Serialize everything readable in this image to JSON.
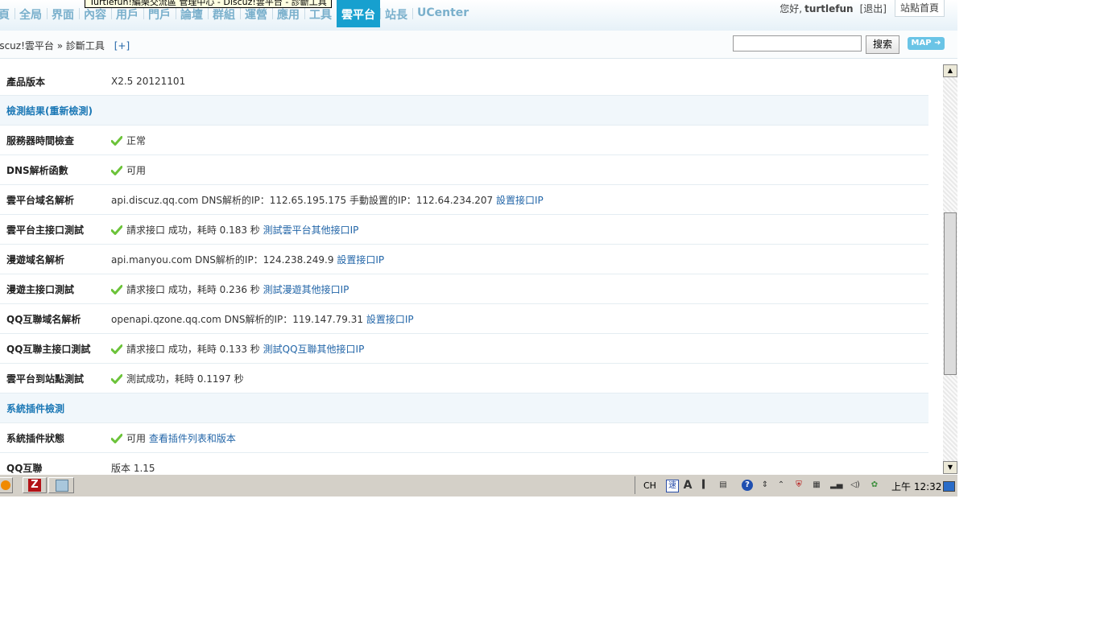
{
  "tooltip": "Turtlefun!編樂交流區 管理中心 - Discuz!雲平台 - 診斷工具",
  "nav": [
    "首頁",
    "全局",
    "界面",
    "內容",
    "用戶",
    "門戶",
    "論壇",
    "群組",
    "運營",
    "應用",
    "工具",
    "雲平台",
    "站長",
    "UCenter"
  ],
  "nav_display": [
    "頁",
    "全局",
    "界面",
    "內容",
    "用戶",
    "門戶",
    "論壇",
    "群組",
    "運營",
    "應用",
    "工具",
    "雲平台",
    "站長",
    "UCenter"
  ],
  "nav_active": "雲平台",
  "user": {
    "greeting": "您好,",
    "name": "turtlefun",
    "logout": "[退出]",
    "site_home": "站點首頁"
  },
  "breadcrumb": {
    "root": "Discuz!雲平台",
    "separator": "»",
    "current": "診斷工具",
    "add": "[+]"
  },
  "breadcrumb_display_root": "iscuz!雲平台",
  "search": {
    "value": "",
    "button": "搜索"
  },
  "map_button": "MAP",
  "rows": [
    {
      "type": "row",
      "key": "產品版本",
      "text": "X2.5 20121101"
    },
    {
      "type": "section",
      "title": "檢測結果(重新檢測)"
    },
    {
      "type": "row",
      "key": "服務器時間檢查",
      "ok": true,
      "text": "正常"
    },
    {
      "type": "row",
      "key": "DNS解析函數",
      "ok": true,
      "text": "可用"
    },
    {
      "type": "row",
      "key": "雲平台域名解析",
      "text": "api.discuz.qq.com DNS解析的IP：112.65.195.175 手動設置的IP：112.64.234.207",
      "link": "設置接口IP"
    },
    {
      "type": "row",
      "key": "雲平台主接口測試",
      "ok": true,
      "text": "請求接口 成功，耗時 0.183 秒",
      "link": "測試雲平台其他接口IP"
    },
    {
      "type": "row",
      "key": "漫遊域名解析",
      "text": "api.manyou.com DNS解析的IP：124.238.249.9",
      "link": "設置接口IP"
    },
    {
      "type": "row",
      "key": "漫遊主接口測試",
      "ok": true,
      "text": "請求接口 成功，耗時 0.236 秒",
      "link": "測試漫遊其他接口IP"
    },
    {
      "type": "row",
      "key": "QQ互聯域名解析",
      "text": "openapi.qzone.qq.com DNS解析的IP：119.147.79.31",
      "link": "設置接口IP"
    },
    {
      "type": "row",
      "key": "QQ互聯主接口測試",
      "ok": true,
      "text": "請求接口 成功，耗時 0.133 秒",
      "link": "測試QQ互聯其他接口IP"
    },
    {
      "type": "row",
      "key": "雲平台到站點測試",
      "ok": true,
      "text": "測試成功，耗時 0.1197 秒"
    },
    {
      "type": "section",
      "title": "系統插件檢測"
    },
    {
      "type": "row",
      "key": "系統插件狀態",
      "ok": true,
      "text": "可用",
      "link": "查看插件列表和版本"
    },
    {
      "type": "row",
      "key": "QQ互聯",
      "text": "版本 1.15"
    }
  ],
  "taskbar": {
    "lang": "CH",
    "time": "上午 12:32",
    "filezilla": "Z"
  },
  "colors": {
    "accent": "#17a0cf",
    "link": "#2366a8",
    "section_text": "#1a77b5",
    "ok": "#6cc33a"
  }
}
